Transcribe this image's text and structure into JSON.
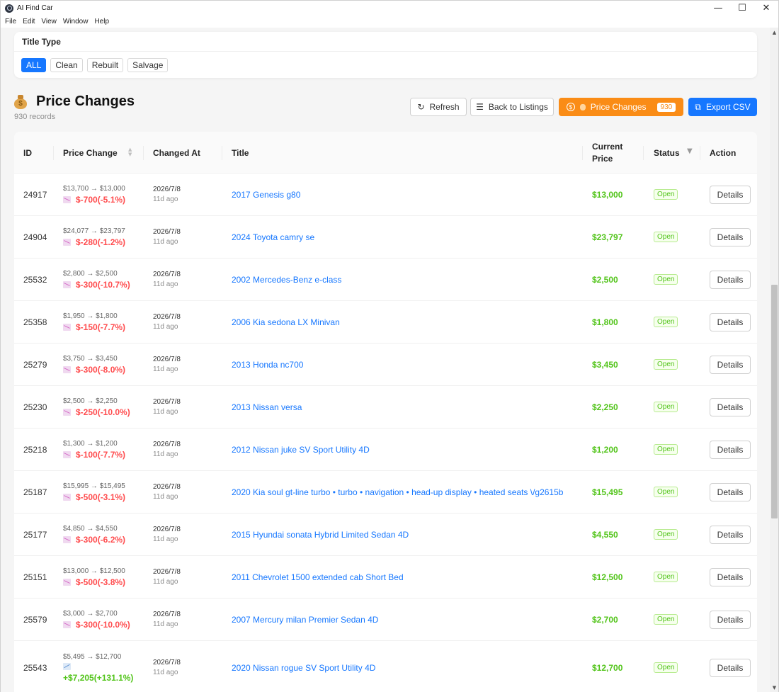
{
  "window": {
    "title": "AI Find Car",
    "controls": {
      "minimize": "—",
      "maximize": "☐",
      "close": "✕"
    }
  },
  "menu": [
    "File",
    "Edit",
    "View",
    "Window",
    "Help"
  ],
  "filter": {
    "label": "Title Type",
    "options": [
      "ALL",
      "Clean",
      "Rebuilt",
      "Salvage"
    ],
    "selected": "ALL"
  },
  "header": {
    "title": "Price Changes",
    "records": "930 records"
  },
  "toolbar": {
    "refresh": "Refresh",
    "back": "Back to Listings",
    "price_changes": "Price Changes",
    "price_changes_count": "930",
    "export": "Export CSV"
  },
  "colors": {
    "primary": "#1677ff",
    "orange": "#fa8c16",
    "decrease": "#ff4d4f",
    "increase": "#52c41a"
  },
  "table": {
    "columns": {
      "id": "ID",
      "price_change": "Price Change",
      "changed_at": "Changed At",
      "title": "Title",
      "current_price_1": "Current",
      "current_price_2": "Price",
      "status": "Status",
      "action": "Action"
    },
    "rows": [
      {
        "id": "24917",
        "range": "$13,700 → $13,000",
        "delta": "$-700(-5.1%)",
        "dir": "down",
        "date": "2026/7/8",
        "ago": "11d ago",
        "title": "2017 Genesis g80",
        "price": "$13,000",
        "status": "Open",
        "action": "Details"
      },
      {
        "id": "24904",
        "range": "$24,077 → $23,797",
        "delta": "$-280(-1.2%)",
        "dir": "down",
        "date": "2026/7/8",
        "ago": "11d ago",
        "title": "2024 Toyota camry se",
        "price": "$23,797",
        "status": "Open",
        "action": "Details"
      },
      {
        "id": "25532",
        "range": "$2,800 → $2,500",
        "delta": "$-300(-10.7%)",
        "dir": "down",
        "date": "2026/7/8",
        "ago": "11d ago",
        "title": "2002 Mercedes-Benz e-class",
        "price": "$2,500",
        "status": "Open",
        "action": "Details"
      },
      {
        "id": "25358",
        "range": "$1,950 → $1,800",
        "delta": "$-150(-7.7%)",
        "dir": "down",
        "date": "2026/7/8",
        "ago": "11d ago",
        "title": "2006 Kia sedona LX Minivan",
        "price": "$1,800",
        "status": "Open",
        "action": "Details"
      },
      {
        "id": "25279",
        "range": "$3,750 → $3,450",
        "delta": "$-300(-8.0%)",
        "dir": "down",
        "date": "2026/7/8",
        "ago": "11d ago",
        "title": "2013 Honda nc700",
        "price": "$3,450",
        "status": "Open",
        "action": "Details"
      },
      {
        "id": "25230",
        "range": "$2,500 → $2,250",
        "delta": "$-250(-10.0%)",
        "dir": "down",
        "date": "2026/7/8",
        "ago": "11d ago",
        "title": "2013 Nissan versa",
        "price": "$2,250",
        "status": "Open",
        "action": "Details"
      },
      {
        "id": "25218",
        "range": "$1,300 → $1,200",
        "delta": "$-100(-7.7%)",
        "dir": "down",
        "date": "2026/7/8",
        "ago": "11d ago",
        "title": "2012 Nissan juke SV Sport Utility 4D",
        "price": "$1,200",
        "status": "Open",
        "action": "Details"
      },
      {
        "id": "25187",
        "range": "$15,995 → $15,495",
        "delta": "$-500(-3.1%)",
        "dir": "down",
        "date": "2026/7/8",
        "ago": "11d ago",
        "title": "2020 Kia soul gt-line turbo • turbo • navigation • head-up display • heated seats \\/g2615b",
        "price": "$15,495",
        "status": "Open",
        "action": "Details"
      },
      {
        "id": "25177",
        "range": "$4,850 → $4,550",
        "delta": "$-300(-6.2%)",
        "dir": "down",
        "date": "2026/7/8",
        "ago": "11d ago",
        "title": "2015 Hyundai sonata Hybrid Limited Sedan 4D",
        "price": "$4,550",
        "status": "Open",
        "action": "Details"
      },
      {
        "id": "25151",
        "range": "$13,000 → $12,500",
        "delta": "$-500(-3.8%)",
        "dir": "down",
        "date": "2026/7/8",
        "ago": "11d ago",
        "title": "2011 Chevrolet 1500 extended cab Short Bed",
        "price": "$12,500",
        "status": "Open",
        "action": "Details"
      },
      {
        "id": "25579",
        "range": "$3,000 → $2,700",
        "delta": "$-300(-10.0%)",
        "dir": "down",
        "date": "2026/7/8",
        "ago": "11d ago",
        "title": "2007 Mercury milan Premier Sedan 4D",
        "price": "$2,700",
        "status": "Open",
        "action": "Details"
      },
      {
        "id": "25543",
        "range": "$5,495 → $12,700",
        "delta": "+$7,205(+131.1%)",
        "dir": "up",
        "date": "2026/7/8",
        "ago": "11d ago",
        "title": "2020 Nissan rogue SV Sport Utility 4D",
        "price": "$12,700",
        "status": "Open",
        "action": "Details"
      }
    ]
  }
}
